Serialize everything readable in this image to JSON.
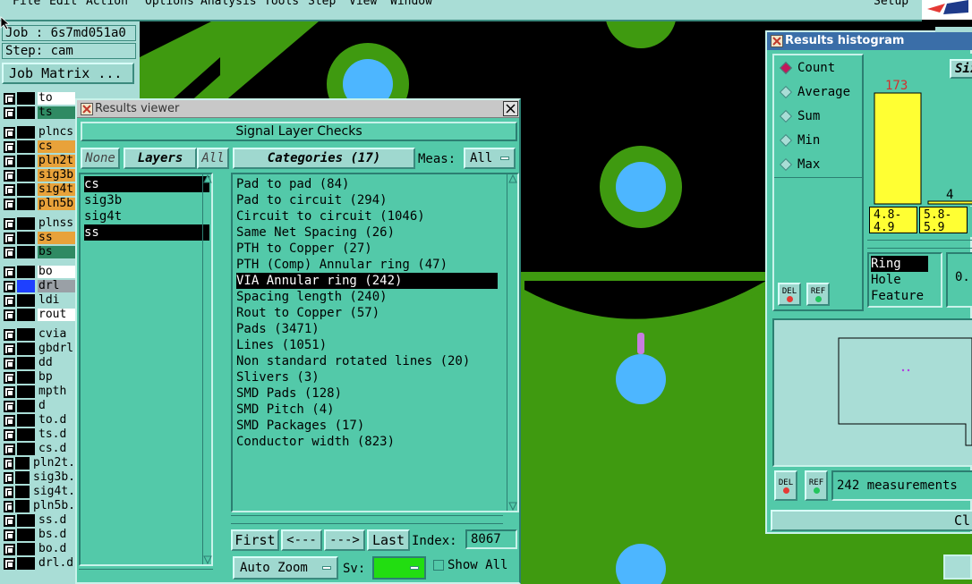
{
  "menubar": {
    "items": [
      "File",
      "Edit",
      "Action",
      "Options",
      "Analysis",
      "Tools",
      "Step",
      "View",
      "Window"
    ],
    "right": "Setup"
  },
  "job": {
    "job_label": "Job : 6s7md051a0",
    "step_label": "Step: cam",
    "matrix_button": "Job Matrix ..."
  },
  "layers": [
    {
      "name": "to",
      "color": "#ffffff"
    },
    {
      "name": "ts",
      "color": "#2f8a63"
    },
    {
      "name": "plncs",
      "color": "#a9ddd6"
    },
    {
      "name": "cs",
      "color": "#e8a23a"
    },
    {
      "name": "pln2t",
      "color": "#e8a23a"
    },
    {
      "name": "sig3b",
      "color": "#e8a23a"
    },
    {
      "name": "sig4t",
      "color": "#e8a23a"
    },
    {
      "name": "pln5b",
      "color": "#e8a23a"
    },
    {
      "name": "plnss",
      "color": "#a9ddd6"
    },
    {
      "name": "ss",
      "color": "#e8a23a"
    },
    {
      "name": "bs",
      "color": "#2f8a63"
    },
    {
      "name": "bo",
      "color": "#ffffff"
    },
    {
      "name": "drl",
      "color": "#9aa0a6"
    },
    {
      "name": "ldi",
      "color": "#a9ddd6"
    },
    {
      "name": "rout",
      "color": "#ffffff"
    },
    {
      "name": "cvia",
      "color": "#a9ddd6"
    },
    {
      "name": "gbdrl",
      "color": "#a9ddd6"
    },
    {
      "name": "dd",
      "color": "#a9ddd6"
    },
    {
      "name": "bp",
      "color": "#a9ddd6"
    },
    {
      "name": "mpth",
      "color": "#a9ddd6"
    },
    {
      "name": "d",
      "color": "#a9ddd6"
    },
    {
      "name": "to.d",
      "color": "#a9ddd6"
    },
    {
      "name": "ts.d",
      "color": "#a9ddd6"
    },
    {
      "name": "cs.d",
      "color": "#a9ddd6"
    },
    {
      "name": "pln2t.",
      "color": "#a9ddd6"
    },
    {
      "name": "sig3b.",
      "color": "#a9ddd6"
    },
    {
      "name": "sig4t.",
      "color": "#a9ddd6"
    },
    {
      "name": "pln5b.",
      "color": "#a9ddd6"
    },
    {
      "name": "ss.d",
      "color": "#a9ddd6"
    },
    {
      "name": "bs.d",
      "color": "#a9ddd6"
    },
    {
      "name": "bo.d",
      "color": "#a9ddd6"
    },
    {
      "name": "drl.d",
      "color": "#a9ddd6"
    }
  ],
  "results_viewer": {
    "title": "Results viewer",
    "header": "Signal Layer Checks",
    "btn_none": "None",
    "btn_layers": "Layers",
    "btn_all": "All",
    "categories_button": "Categories (17)",
    "meas_label": "Meas:",
    "meas_value": "All",
    "layers_list": [
      "cs",
      "sig3b",
      "sig4t",
      "ss"
    ],
    "categories": [
      "Pad to pad (84)",
      "Pad to circuit (294)",
      "Circuit to circuit (1046)",
      "Same Net Spacing (26)",
      "PTH to Copper (27)",
      "PTH (Comp) Annular ring (47)",
      "VIA Annular ring (242)",
      "Spacing length (240)",
      "Rout to Copper (57)",
      "Pads (3471)",
      "Lines (1051)",
      "Non standard rotated lines (20)",
      "Slivers (3)",
      "SMD Pads (128)",
      "SMD Pitch (4)",
      "SMD Packages (17)",
      "Conductor width (823)"
    ],
    "nav": {
      "first": "First",
      "prev": "<---",
      "next": "--->",
      "last": "Last",
      "index_label": "Index:",
      "index_value": "8067"
    },
    "auto_zoom": "Auto Zoom",
    "sv_label": "Sv:",
    "show_all": "Show All"
  },
  "histogram": {
    "title": "Results histogram",
    "options": [
      "Count",
      "Average",
      "Sum",
      "Min",
      "Max"
    ],
    "selected": "Count",
    "size_label": "Siz",
    "bars": [
      {
        "label": "4.8-4.9",
        "value": 173
      },
      {
        "label": "5.8-5.9",
        "value": 4
      }
    ],
    "bar_value_1": "173",
    "bar_value_2": "4",
    "bin_label_1": "4.8-4.9",
    "bin_label_2": "5.8-5.9",
    "attr_list": [
      "Ring",
      "Hole",
      "Feature"
    ],
    "del": "DEL",
    "ref": "REF",
    "partial_value": "0.",
    "measurements": "242 measurements",
    "close": "Cl"
  },
  "colors": {
    "panel": "#53c9a9",
    "pcb_green": "#3f9a10",
    "pad_blue": "#4db6ff",
    "bar_yellow": "#ffff33",
    "selection": "#000000"
  }
}
